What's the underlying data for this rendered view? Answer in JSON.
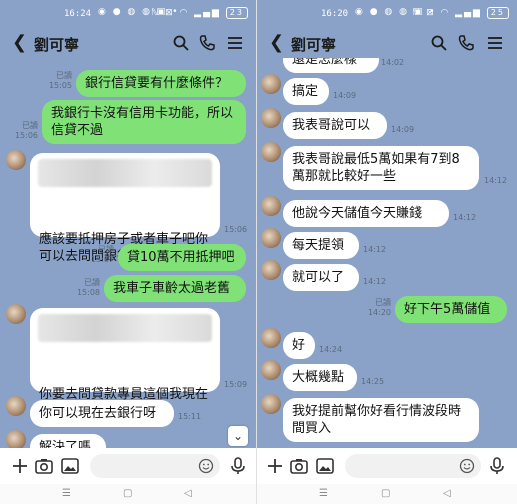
{
  "left": {
    "status": {
      "time": "16:24",
      "battery": "23"
    },
    "header": {
      "title": "劉可寧"
    },
    "messages": {
      "m1": {
        "text": "銀行信貸要有什麼條件？",
        "read": "已讀",
        "time": "15:05"
      },
      "m2": {
        "text": "我銀行卡沒有信用卡功能，所以信貸不過",
        "read": "已讀",
        "time": "15:06"
      },
      "m3": {
        "text": "應該要抵押房子或者車子吧你可以去問問銀行看",
        "time": "15:06"
      },
      "m4": {
        "text": "貸10萬不用抵押吧",
        "read": "已讀",
        "time": "15:07"
      },
      "m5": {
        "text": "我車子車齡太過老舊",
        "read": "已讀",
        "time": "15:08"
      },
      "m6": {
        "text": "你要去問貸款專員這個我現在還不怎麼了解",
        "time": "15:09"
      },
      "m7": {
        "text": "你可以現在去銀行呀",
        "time": "15:11"
      },
      "m8": {
        "text": "解決了嗎"
      }
    }
  },
  "right": {
    "status": {
      "time": "16:20",
      "battery": "25"
    },
    "header": {
      "title": "劉可寧"
    },
    "messages": {
      "r0": {
        "text": "還是怎麼樣",
        "time": "14:02"
      },
      "r1": {
        "text": "搞定",
        "time": "14:09"
      },
      "r2": {
        "text": "我表哥說可以",
        "time": "14:09"
      },
      "r3": {
        "text": "我表哥說最低5萬如果有7到8萬那就比較好一些",
        "time": "14:12"
      },
      "r4": {
        "text": "他說今天儲值今天賺錢",
        "time": "14:12"
      },
      "r5": {
        "text": "每天提領",
        "time": "14:12"
      },
      "r6": {
        "text": "就可以了",
        "time": "14:12"
      },
      "r7": {
        "text": "好下午5萬儲值",
        "read": "已讀",
        "time": "14:20"
      },
      "r8": {
        "text": "好",
        "time": "14:24"
      },
      "r9": {
        "text": "大概幾點",
        "time": "14:25"
      },
      "r10": {
        "text": "我好提前幫你好看行情波段時間買入"
      }
    }
  },
  "icons": {
    "back": "chevron-left-icon",
    "search": "search-icon",
    "phone": "phone-icon",
    "menu": "menu-icon",
    "plus": "plus-icon",
    "camera": "camera-icon",
    "image": "image-icon",
    "emoji": "emoji-icon",
    "mic": "mic-icon",
    "scroll": "arrow-down-icon"
  },
  "colors": {
    "chat_bg": "#8aa2c8",
    "my_bubble": "#80e177",
    "their_bubble": "#ffffff"
  }
}
